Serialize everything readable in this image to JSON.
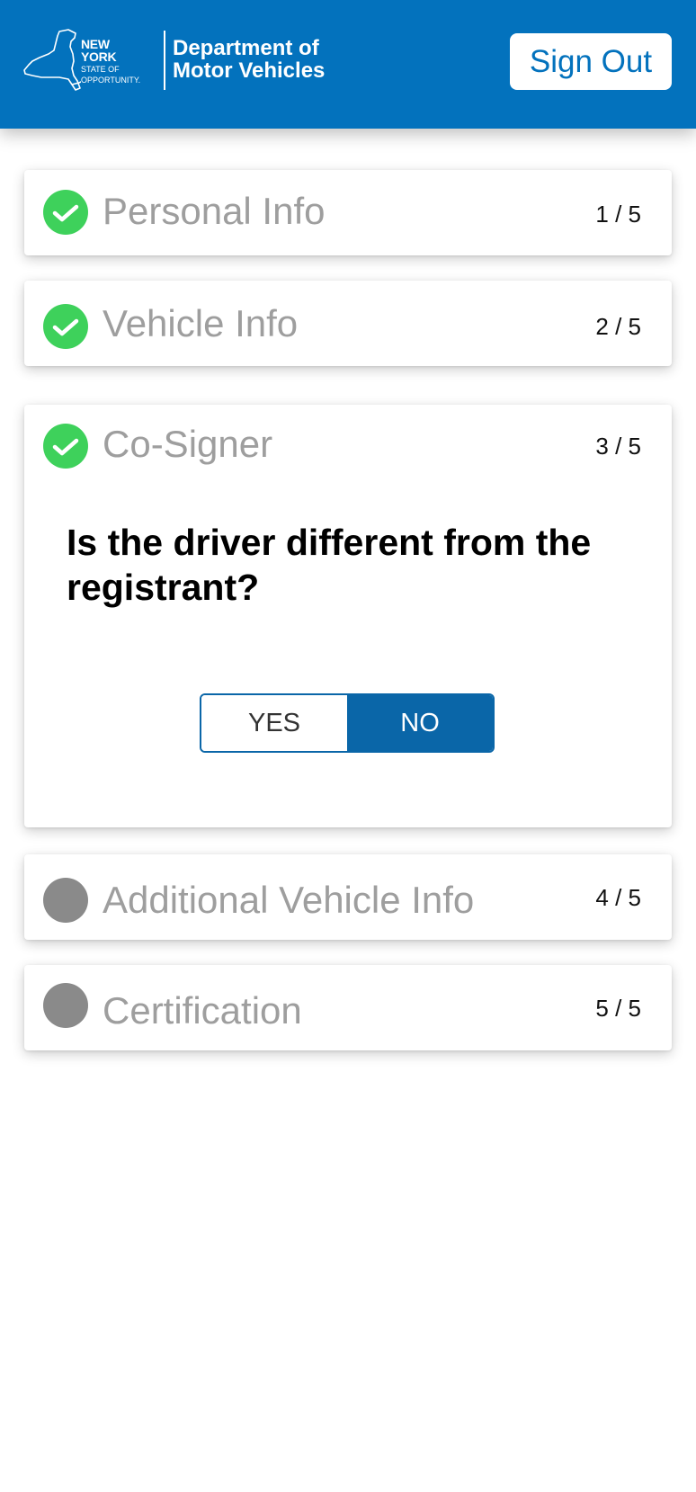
{
  "header": {
    "logo_state": "NEW YORK",
    "logo_tagline_1": "STATE OF",
    "logo_tagline_2": "OPPORTUNITY.",
    "title_line_1": "Department of",
    "title_line_2": "Motor Vehicles",
    "sign_out_label": "Sign Out"
  },
  "colors": {
    "header_bg": "#0372bd",
    "step_done": "#3ed15b",
    "step_pending": "#8a8a8a",
    "toggle_selected": "#0a66a8"
  },
  "steps": [
    {
      "label": "Personal Info",
      "count": "1 / 5",
      "status": "done",
      "icon": "check-circle-icon"
    },
    {
      "label": "Vehicle Info",
      "count": "2 / 5",
      "status": "done",
      "icon": "check-circle-icon"
    },
    {
      "label": "Co-Signer",
      "count": "3 / 5",
      "status": "done",
      "icon": "check-circle-icon"
    },
    {
      "label": "Additional Vehicle Info",
      "count": "4 / 5",
      "status": "pending",
      "icon": "pending-circle-icon"
    },
    {
      "label": "Certification",
      "count": "5 / 5",
      "status": "pending",
      "icon": "pending-circle-icon"
    }
  ],
  "cosigner": {
    "question": "Is the driver different from the registrant?",
    "options": [
      "YES",
      "NO"
    ],
    "selected": "NO"
  }
}
